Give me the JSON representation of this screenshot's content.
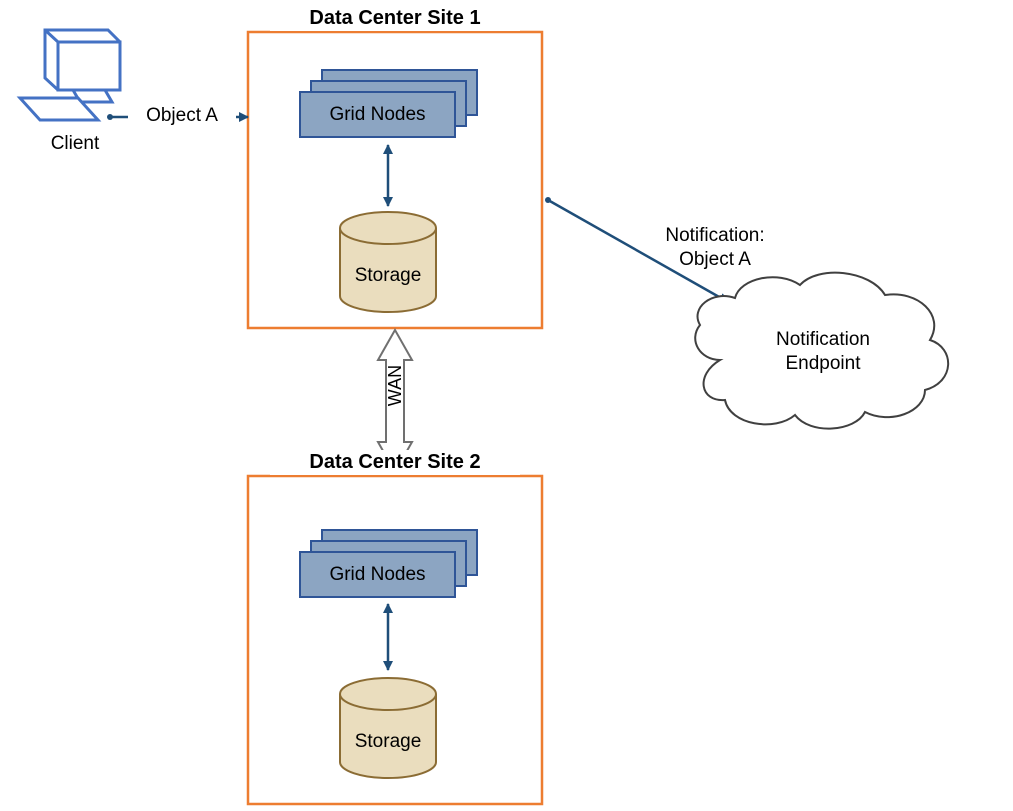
{
  "client": {
    "label": "Client"
  },
  "object_arrow": {
    "label": "Object A"
  },
  "site1": {
    "title": "Data Center Site 1",
    "nodes_label": "Grid Nodes",
    "storage_label": "Storage"
  },
  "site2": {
    "title": "Data Center Site 2",
    "nodes_label": "Grid Nodes",
    "storage_label": "Storage"
  },
  "wan": {
    "label": "WAN"
  },
  "notification": {
    "label": "Notification:\nObject A",
    "endpoint_label": "Notification\nEndpoint"
  },
  "colors": {
    "site_border": "#ED7D31",
    "node_fill": "#8CA5C2",
    "node_border": "#2F5597",
    "storage_fill": "#EADDBE",
    "storage_border": "#8B6C34",
    "computer": "#4472C4",
    "arrow": "#1F4E79"
  }
}
